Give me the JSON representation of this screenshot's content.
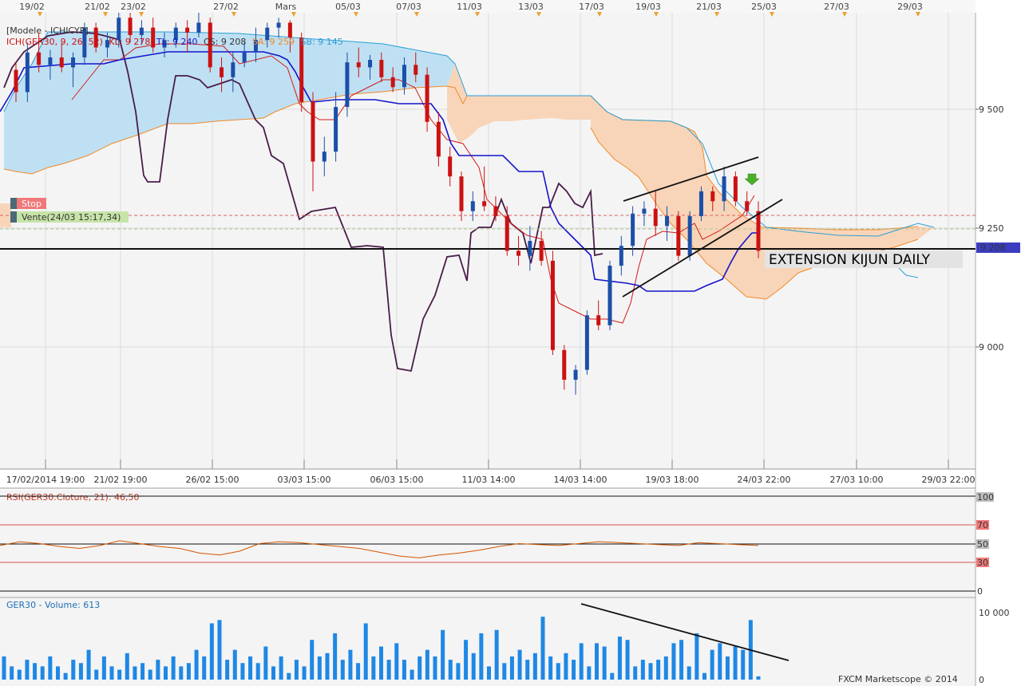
{
  "top_dates": [
    "19/02",
    "21/02",
    "23/02",
    "27/02",
    "Mars",
    "05/03",
    "07/03",
    "11/03",
    "13/03",
    "17/03",
    "19/03",
    "21/03",
    "25/03",
    "27/03",
    "29/03"
  ],
  "bottom_dates": [
    "17/02/2014 19:00",
    "21/02 19:00",
    "26/02 15:00",
    "03/03 15:00",
    "06/03 15:00",
    "11/03 14:00",
    "14/03 14:00",
    "19/03 18:00",
    "24/03 22:00",
    "27/03 10:00",
    "29/03 22:00"
  ],
  "legend": {
    "title": "[Modele - ICHICYP]",
    "ich": "ICH(GER30, 9, 26, 52)",
    "kl": "KL: 9 278",
    "tl": "TL: 9 240",
    "cs": "CS: 9 208",
    "sa": "SA: 9 259",
    "sb": "SB: 9 145"
  },
  "orders": {
    "stop": "Stop",
    "sell": "Vente(24/03 15:17,34)"
  },
  "annotation": "EXTENSION KIJUN DAILY",
  "price_axis": {
    "labels": [
      "9 500",
      "9 250",
      "9 000"
    ],
    "current": "9 208"
  },
  "rsi": {
    "label": "RSI(GER30.Cloture, 21): 46,50",
    "levels": [
      "100",
      "70",
      "50",
      "30",
      "0"
    ]
  },
  "volume": {
    "label": "GER30 - Volume: 613",
    "levels": [
      "10 000",
      "0"
    ]
  },
  "footer": "FXCM Marketscope © 2014",
  "colors": {
    "bull": "#1b4fa8",
    "bear": "#cc1111",
    "tenkan": "#d31a1a",
    "kijun": "#1414cc",
    "chikou": "#4a1c4a",
    "cloud_bull": "#bfe0f3",
    "cloud_bear": "#f8d5b9",
    "volume": "#1e88e5"
  },
  "chart_data": {
    "type": "candlestick",
    "ylim": [
      8760,
      9680
    ],
    "levels": {
      "current": 9208,
      "stop": 9273,
      "sell": 9245
    },
    "candles": [
      [
        9565,
        9580,
        9500,
        9520
      ],
      [
        9520,
        9620,
        9500,
        9600
      ],
      [
        9600,
        9640,
        9560,
        9575
      ],
      [
        9575,
        9605,
        9545,
        9590
      ],
      [
        9590,
        9620,
        9560,
        9570
      ],
      [
        9570,
        9600,
        9530,
        9590
      ],
      [
        9590,
        9660,
        9575,
        9650
      ],
      [
        9650,
        9660,
        9600,
        9610
      ],
      [
        9610,
        9640,
        9590,
        9625
      ],
      [
        9625,
        9680,
        9610,
        9670
      ],
      [
        9670,
        9680,
        9620,
        9635
      ],
      [
        9635,
        9665,
        9615,
        9650
      ],
      [
        9650,
        9670,
        9600,
        9610
      ],
      [
        9610,
        9640,
        9590,
        9625
      ],
      [
        9625,
        9660,
        9610,
        9650
      ],
      [
        9650,
        9665,
        9600,
        9640
      ],
      [
        9640,
        9680,
        9630,
        9660
      ],
      [
        9660,
        9670,
        9560,
        9570
      ],
      [
        9570,
        9590,
        9520,
        9550
      ],
      [
        9550,
        9600,
        9520,
        9580
      ],
      [
        9580,
        9620,
        9570,
        9600
      ],
      [
        9600,
        9650,
        9580,
        9625
      ],
      [
        9625,
        9660,
        9610,
        9650
      ],
      [
        9650,
        9670,
        9630,
        9660
      ],
      [
        9660,
        9665,
        9600,
        9630
      ],
      [
        9630,
        9640,
        9480,
        9500
      ],
      [
        9500,
        9520,
        9320,
        9380
      ],
      [
        9380,
        9430,
        9350,
        9400
      ],
      [
        9400,
        9520,
        9380,
        9490
      ],
      [
        9490,
        9600,
        9470,
        9580
      ],
      [
        9580,
        9610,
        9550,
        9570
      ],
      [
        9570,
        9595,
        9545,
        9585
      ],
      [
        9585,
        9600,
        9540,
        9550
      ],
      [
        9550,
        9570,
        9520,
        9530
      ],
      [
        9530,
        9590,
        9515,
        9575
      ],
      [
        9575,
        9600,
        9540,
        9555
      ],
      [
        9555,
        9570,
        9440,
        9460
      ],
      [
        9460,
        9480,
        9370,
        9390
      ],
      [
        9390,
        9410,
        9330,
        9350
      ],
      [
        9350,
        9360,
        9260,
        9280
      ],
      [
        9280,
        9320,
        9260,
        9300
      ],
      [
        9300,
        9370,
        9280,
        9290
      ],
      [
        9290,
        9310,
        9260,
        9270
      ],
      [
        9270,
        9290,
        9190,
        9200
      ],
      [
        9200,
        9230,
        9170,
        9190
      ],
      [
        9190,
        9250,
        9160,
        9220
      ],
      [
        9220,
        9240,
        9170,
        9180
      ],
      [
        9180,
        9200,
        8990,
        9000
      ],
      [
        9000,
        9010,
        8920,
        8940
      ],
      [
        8940,
        8970,
        8910,
        8960
      ],
      [
        8960,
        9080,
        8950,
        9070
      ],
      [
        9070,
        9100,
        9040,
        9050
      ],
      [
        9050,
        9180,
        9040,
        9170
      ],
      [
        9170,
        9230,
        9150,
        9210
      ],
      [
        9210,
        9290,
        9190,
        9275
      ],
      [
        9275,
        9300,
        9250,
        9285
      ],
      [
        9285,
        9320,
        9230,
        9250
      ],
      [
        9250,
        9290,
        9220,
        9270
      ],
      [
        9270,
        9280,
        9180,
        9190
      ],
      [
        9190,
        9280,
        9180,
        9270
      ],
      [
        9270,
        9330,
        9260,
        9320
      ],
      [
        9320,
        9330,
        9280,
        9300
      ],
      [
        9300,
        9370,
        9280,
        9350
      ],
      [
        9350,
        9360,
        9290,
        9300
      ],
      [
        9300,
        9320,
        9270,
        9280
      ],
      [
        9280,
        9300,
        9185,
        9200
      ]
    ],
    "rsi": [
      48,
      52,
      50,
      47,
      45,
      48,
      53,
      50,
      47,
      45,
      40,
      38,
      42,
      50,
      52,
      51,
      49,
      47,
      45,
      41,
      37,
      35,
      38,
      40,
      43,
      47,
      50,
      49,
      48,
      50,
      52,
      51,
      50,
      49,
      48,
      51,
      50,
      49,
      48
    ]
  }
}
